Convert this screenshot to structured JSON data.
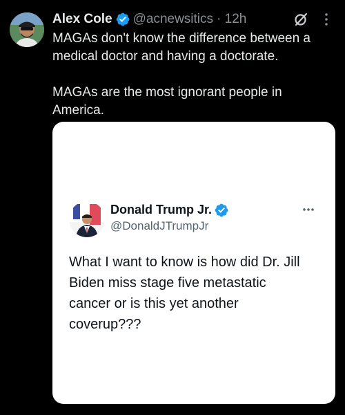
{
  "tweet": {
    "author_name": "Alex Cole",
    "handle": "@acnewsitics",
    "timestamp": "· 12h",
    "text_p1": "MAGAs don't know the difference between a medical doctor and having a doctorate.",
    "text_p2": "MAGAs are the most ignorant people in America.",
    "icons": [
      "verified-icon",
      "grok-icon",
      "more-icon"
    ]
  },
  "quoted": {
    "author_name": "Donald Trump Jr.",
    "handle": "@DonaldJTrumpJr",
    "text": "What I want to know is how did Dr. Jill Biden miss stage five metastatic cancer or is this yet another coverup???",
    "icons": [
      "verified-icon",
      "more-icon"
    ]
  },
  "colors": {
    "background": "#000000",
    "text_primary": "#e7e9ea",
    "text_secondary": "#8b9096",
    "verified_blue": "#1d9bf0",
    "card_background": "#ffffff",
    "card_text": "#0f1419",
    "card_secondary": "#536471"
  }
}
